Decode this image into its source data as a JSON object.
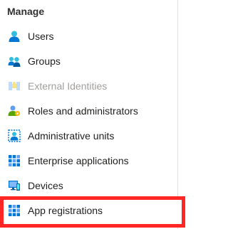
{
  "section": {
    "title": "Manage"
  },
  "nav": {
    "items": [
      {
        "label": "Users",
        "icon": "user-icon",
        "disabled": false
      },
      {
        "label": "Groups",
        "icon": "groups-icon",
        "disabled": false
      },
      {
        "label": "External Identities",
        "icon": "external-identities-icon",
        "disabled": true
      },
      {
        "label": "Roles and administrators",
        "icon": "roles-icon",
        "disabled": false
      },
      {
        "label": "Administrative units",
        "icon": "admin-units-icon",
        "disabled": false
      },
      {
        "label": "Enterprise applications",
        "icon": "enterprise-apps-icon",
        "disabled": false
      },
      {
        "label": "Devices",
        "icon": "devices-icon",
        "disabled": false
      },
      {
        "label": "App registrations",
        "icon": "app-registrations-icon",
        "disabled": false,
        "highlighted": true
      }
    ]
  },
  "colors": {
    "highlight": "#ff2626",
    "primary_blue": "#0078d4",
    "disabled_text": "#a19f9d"
  }
}
